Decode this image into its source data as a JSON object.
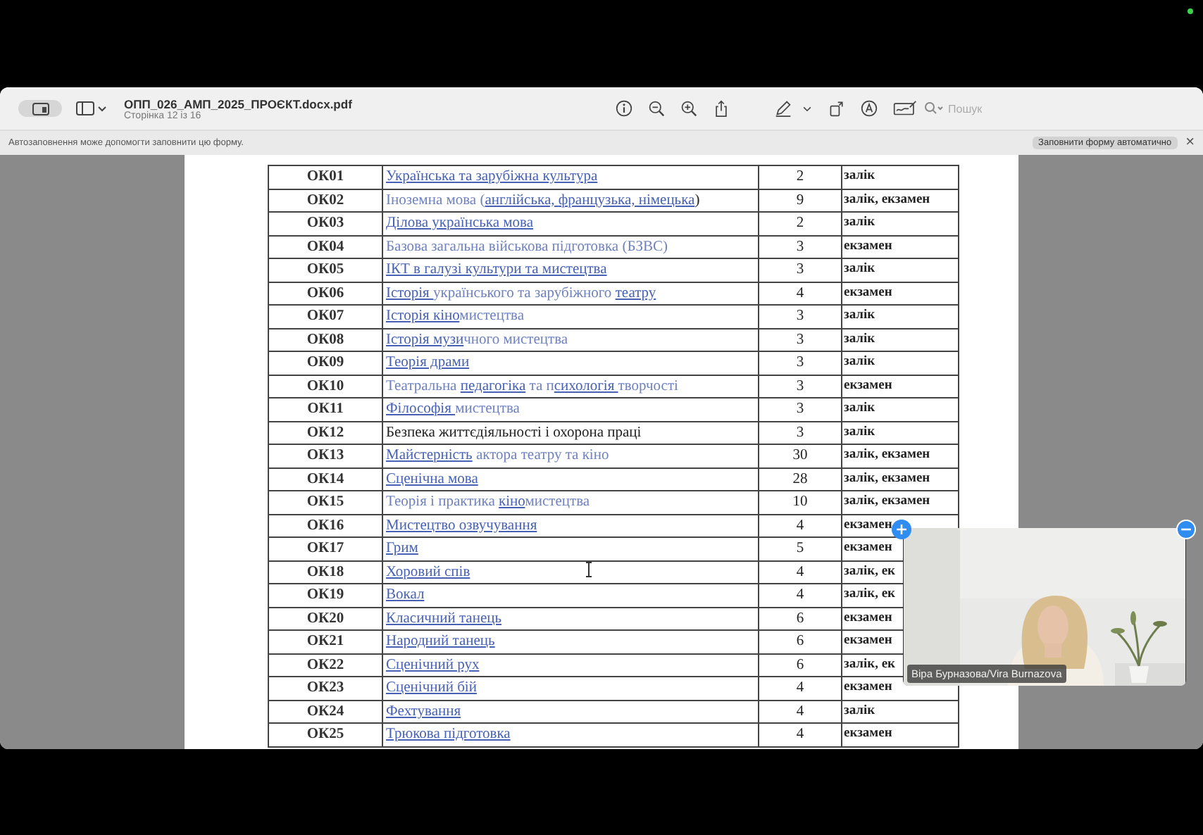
{
  "window": {
    "title": "ОПП_026_АМП_2025_ПРОЄКТ.docx.pdf",
    "subtitle": "Сторінка 12 із 16"
  },
  "search": {
    "placeholder": "Пошук"
  },
  "autofill": {
    "message": "Автозаповнення може допомогти заповнити цю форму.",
    "button": "Заповнити форму автоматично",
    "close": "×"
  },
  "table": {
    "rows": [
      {
        "code": "ОК01",
        "name": [
          {
            "text": "Українська та зарубіжна культура",
            "kind": "link"
          }
        ],
        "credits": "2",
        "control": "залік"
      },
      {
        "code": "ОК02",
        "name": [
          {
            "text": "Іноземна мова (",
            "kind": "blue"
          },
          {
            "text": "англійська, ",
            "kind": "link"
          },
          {
            "text": "французька, німецька",
            "kind": "link"
          },
          {
            "text": ")",
            "kind": "black"
          }
        ],
        "credits": "9",
        "control": "залік, екзамен"
      },
      {
        "code": "ОК03",
        "name": [
          {
            "text": "Ділова українська мова",
            "kind": "link"
          }
        ],
        "credits": "2",
        "control": "залік"
      },
      {
        "code": "ОК04",
        "name": [
          {
            "text": "Базова загальна військова підготовка (БЗВС)",
            "kind": "blue"
          }
        ],
        "credits": "3",
        "control": "екзамен"
      },
      {
        "code": "ОК05",
        "name": [
          {
            "text": "ІКТ в галузі культури та мистецтва",
            "kind": "link"
          }
        ],
        "credits": "3",
        "control": "залік"
      },
      {
        "code": "ОК06",
        "name": [
          {
            "text": "Історія ",
            "kind": "link"
          },
          {
            "text": "українського та зарубіжного ",
            "kind": "blue"
          },
          {
            "text": "театру",
            "kind": "link"
          }
        ],
        "credits": "4",
        "control": "екзамен"
      },
      {
        "code": "ОК07",
        "name": [
          {
            "text": "Історія кіно",
            "kind": "link"
          },
          {
            "text": "мистецтва",
            "kind": "blue"
          }
        ],
        "credits": "3",
        "control": "залік"
      },
      {
        "code": "ОК08",
        "name": [
          {
            "text": "Історія музи",
            "kind": "link"
          },
          {
            "text": "чного мистецтва",
            "kind": "blue"
          }
        ],
        "credits": "3",
        "control": "залік"
      },
      {
        "code": "ОК09",
        "name": [
          {
            "text": "Теорія драми",
            "kind": "link"
          }
        ],
        "credits": "3",
        "control": "залік"
      },
      {
        "code": "ОК10",
        "name": [
          {
            "text": "Театральна ",
            "kind": "blue"
          },
          {
            "text": "педагогіка",
            "kind": "link"
          },
          {
            "text": " та п",
            "kind": "blue"
          },
          {
            "text": "сихологія ",
            "kind": "link"
          },
          {
            "text": "творчості",
            "kind": "blue"
          }
        ],
        "credits": "3",
        "control": "екзамен"
      },
      {
        "code": "ОК11",
        "name": [
          {
            "text": "Філософія ",
            "kind": "link"
          },
          {
            "text": "мистецтва",
            "kind": "blue"
          }
        ],
        "credits": "3",
        "control": "залік"
      },
      {
        "code": "ОК12",
        "name": [
          {
            "text": "Безпека життєдіяльності і охорона праці",
            "kind": "black"
          }
        ],
        "credits": "3",
        "control": "залік"
      },
      {
        "code": "ОК13",
        "name": [
          {
            "text": "Майстерність",
            "kind": "link"
          },
          {
            "text": " актора театру та кіно",
            "kind": "blue"
          }
        ],
        "credits": "30",
        "control": "залік, екзамен"
      },
      {
        "code": "ОК14",
        "name": [
          {
            "text": "Сценічна мова",
            "kind": "link"
          }
        ],
        "credits": "28",
        "control": "залік, екзамен"
      },
      {
        "code": "ОК15",
        "name": [
          {
            "text": "Теорія і практика ",
            "kind": "blue"
          },
          {
            "text": "кіно",
            "kind": "link"
          },
          {
            "text": "мистецтва",
            "kind": "blue"
          }
        ],
        "credits": "10",
        "control": "залік, екзамен"
      },
      {
        "code": "ОК16",
        "name": [
          {
            "text": "Мистецтво озвучування",
            "kind": "link"
          }
        ],
        "credits": "4",
        "control": "екзамен"
      },
      {
        "code": "ОК17",
        "name": [
          {
            "text": "Грим",
            "kind": "link"
          }
        ],
        "credits": "5",
        "control": "екзамен"
      },
      {
        "code": "ОК18",
        "name": [
          {
            "text": "Хоровий спів",
            "kind": "link"
          }
        ],
        "credits": "4",
        "control": "залік, ек"
      },
      {
        "code": "ОК19",
        "name": [
          {
            "text": "Вокал",
            "kind": "link"
          }
        ],
        "credits": "4",
        "control": "залік, ек"
      },
      {
        "code": "ОК20",
        "name": [
          {
            "text": "Класичний танець",
            "kind": "link"
          }
        ],
        "credits": "6",
        "control": "екзамен"
      },
      {
        "code": "ОК21",
        "name": [
          {
            "text": "Народний танець",
            "kind": "link"
          }
        ],
        "credits": "6",
        "control": "екзамен"
      },
      {
        "code": "ОК22",
        "name": [
          {
            "text": "Сценічний рух",
            "kind": "link"
          }
        ],
        "credits": "6",
        "control": "залік, ек"
      },
      {
        "code": "ОК23",
        "name": [
          {
            "text": "Сценічний бій",
            "kind": "link"
          }
        ],
        "credits": "4",
        "control": "екзамен"
      },
      {
        "code": "ОК24",
        "name": [
          {
            "text": "Фехтування",
            "kind": "link"
          }
        ],
        "credits": "4",
        "control": "залік"
      },
      {
        "code": "ОК25",
        "name": [
          {
            "text": "Трюкова підготовка",
            "kind": "link"
          }
        ],
        "credits": "4",
        "control": "екзамен"
      }
    ]
  },
  "video": {
    "name": "Віра Бурназова/Vira Burnazova"
  }
}
